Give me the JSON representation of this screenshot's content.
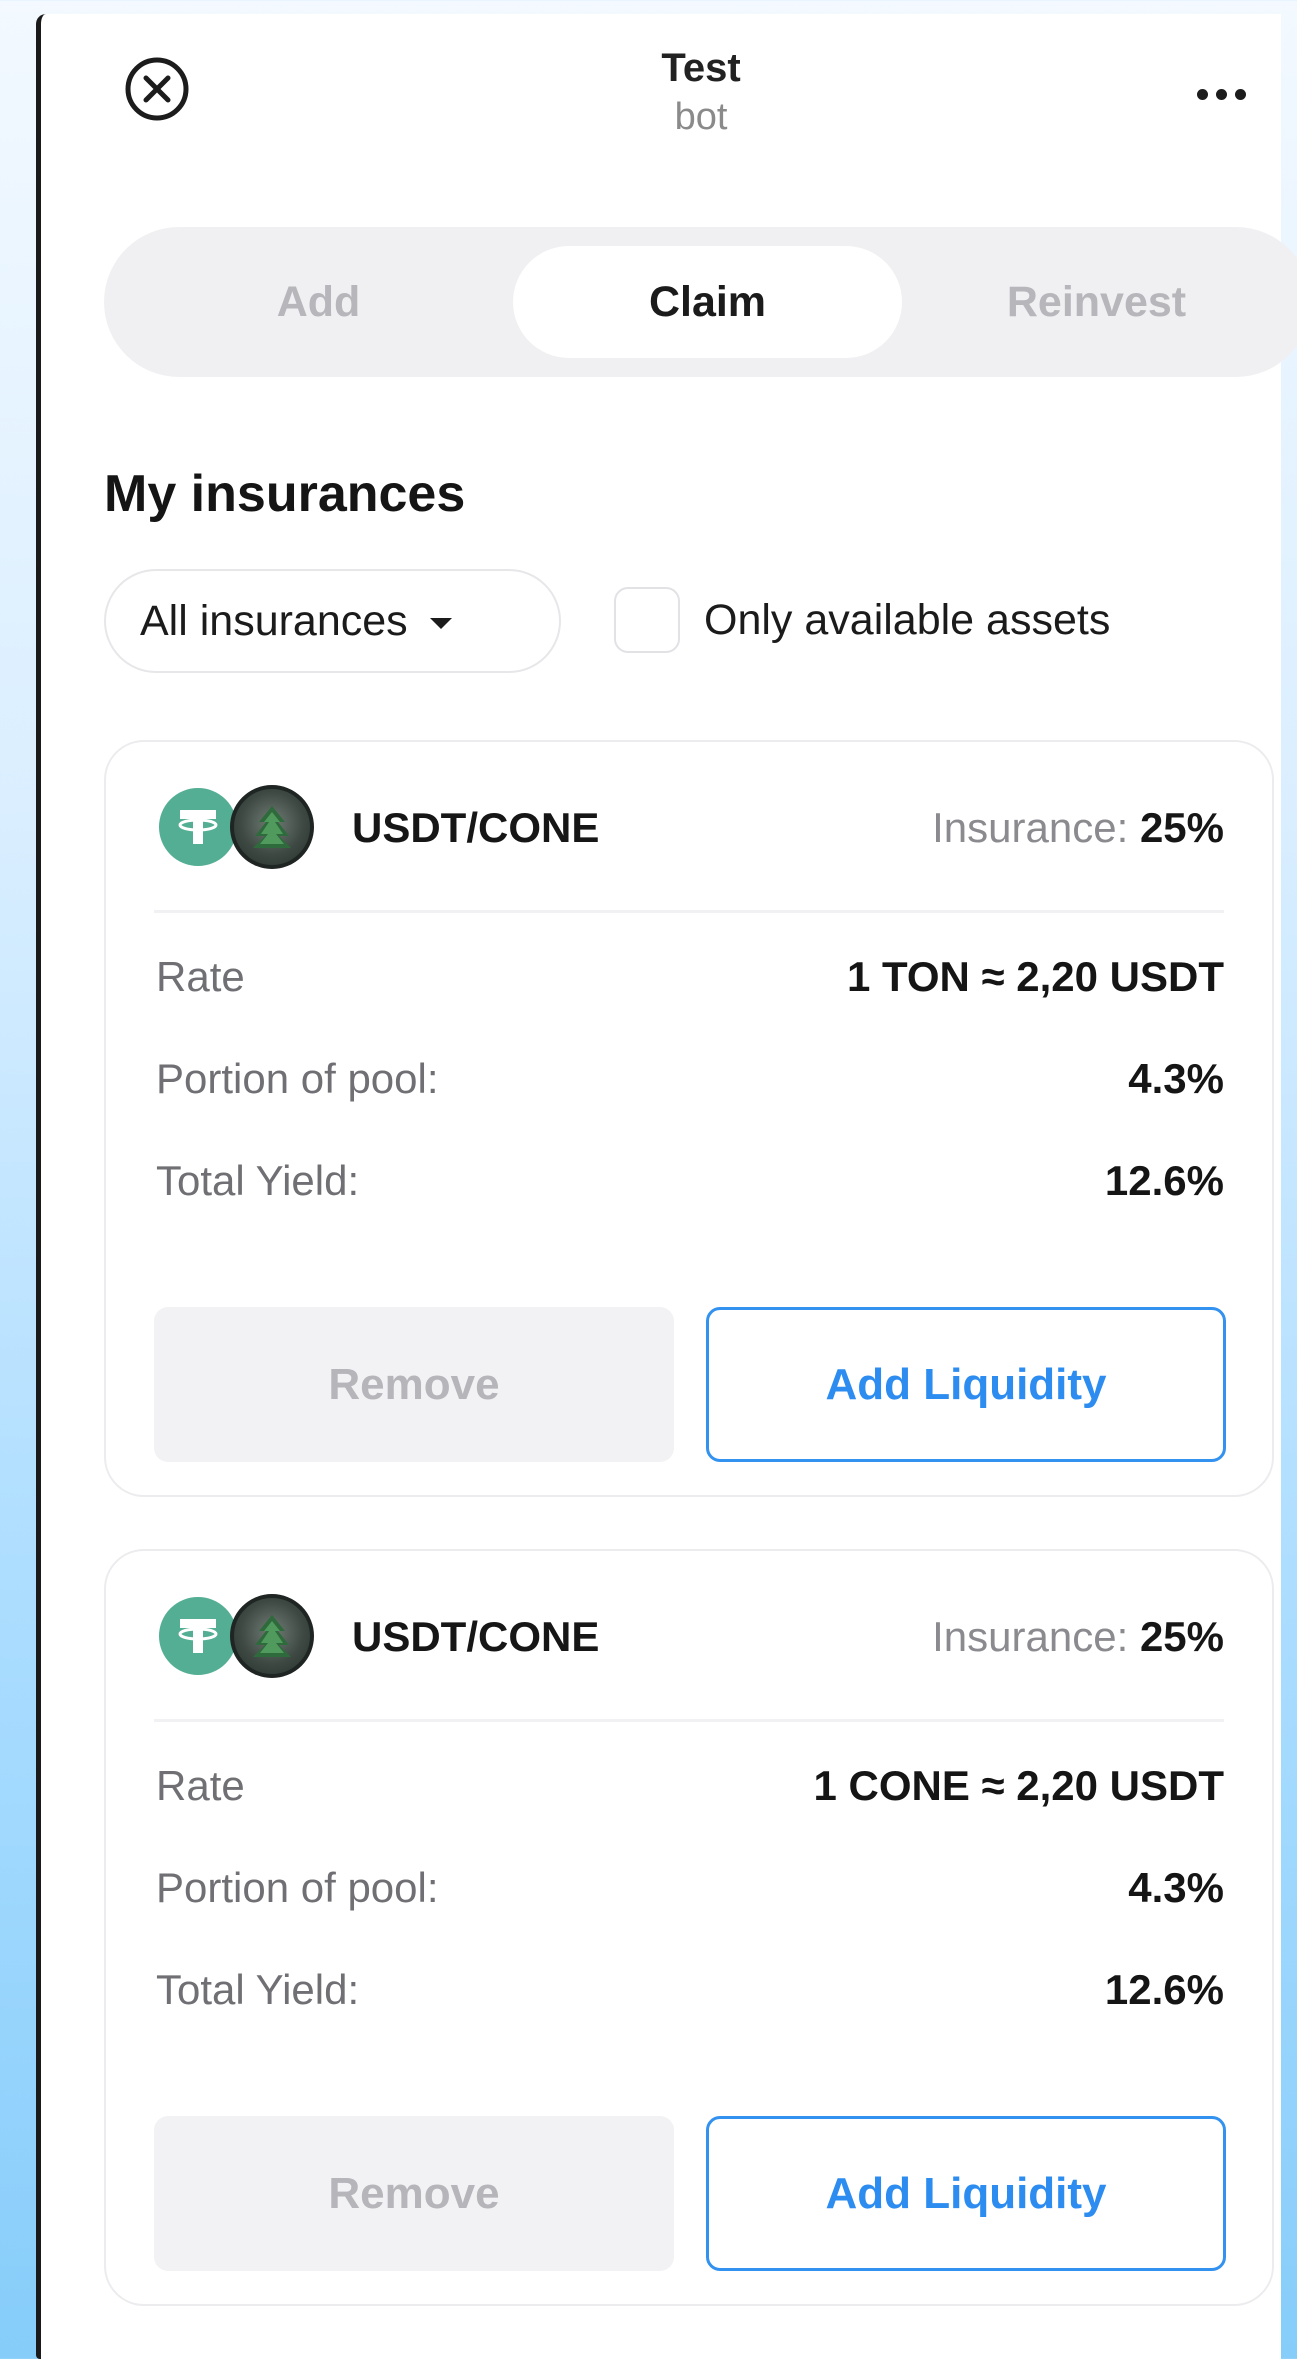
{
  "header": {
    "title": "Test",
    "subtitle": "bot",
    "close_icon": "close-circle-icon",
    "more_icon": "more-horizontal-icon"
  },
  "tabs": [
    {
      "label": "Add",
      "active": false
    },
    {
      "label": "Claim",
      "active": true
    },
    {
      "label": "Reinvest",
      "active": false
    }
  ],
  "section_title": "My insurances",
  "filters": {
    "dropdown_value": "All insurances",
    "checkbox_label": "Only available assets",
    "checkbox_checked": false
  },
  "cards": [
    {
      "pair": "USDT/CONE",
      "insurance_label": "Insurance:",
      "insurance_value": "25%",
      "rows": [
        {
          "label": "Rate",
          "value": "1 TON ≈ 2,20 USDT"
        },
        {
          "label": "Portion of pool:",
          "value": "4.3%"
        },
        {
          "label": "Total Yield:",
          "value": "12.6%"
        }
      ],
      "remove_label": "Remove",
      "add_label": "Add Liquidity"
    },
    {
      "pair": "USDT/CONE",
      "insurance_label": "Insurance:",
      "insurance_value": "25%",
      "rows": [
        {
          "label": "Rate",
          "value": "1 CONE ≈ 2,20 USDT"
        },
        {
          "label": "Portion of pool:",
          "value": "4.3%"
        },
        {
          "label": "Total Yield:",
          "value": "12.6%"
        }
      ],
      "remove_label": "Remove",
      "add_label": "Add Liquidity"
    }
  ],
  "colors": {
    "accent": "#2d8cf0",
    "usdt": "#53ae94",
    "background_gradient_end": "#86cdfa"
  }
}
